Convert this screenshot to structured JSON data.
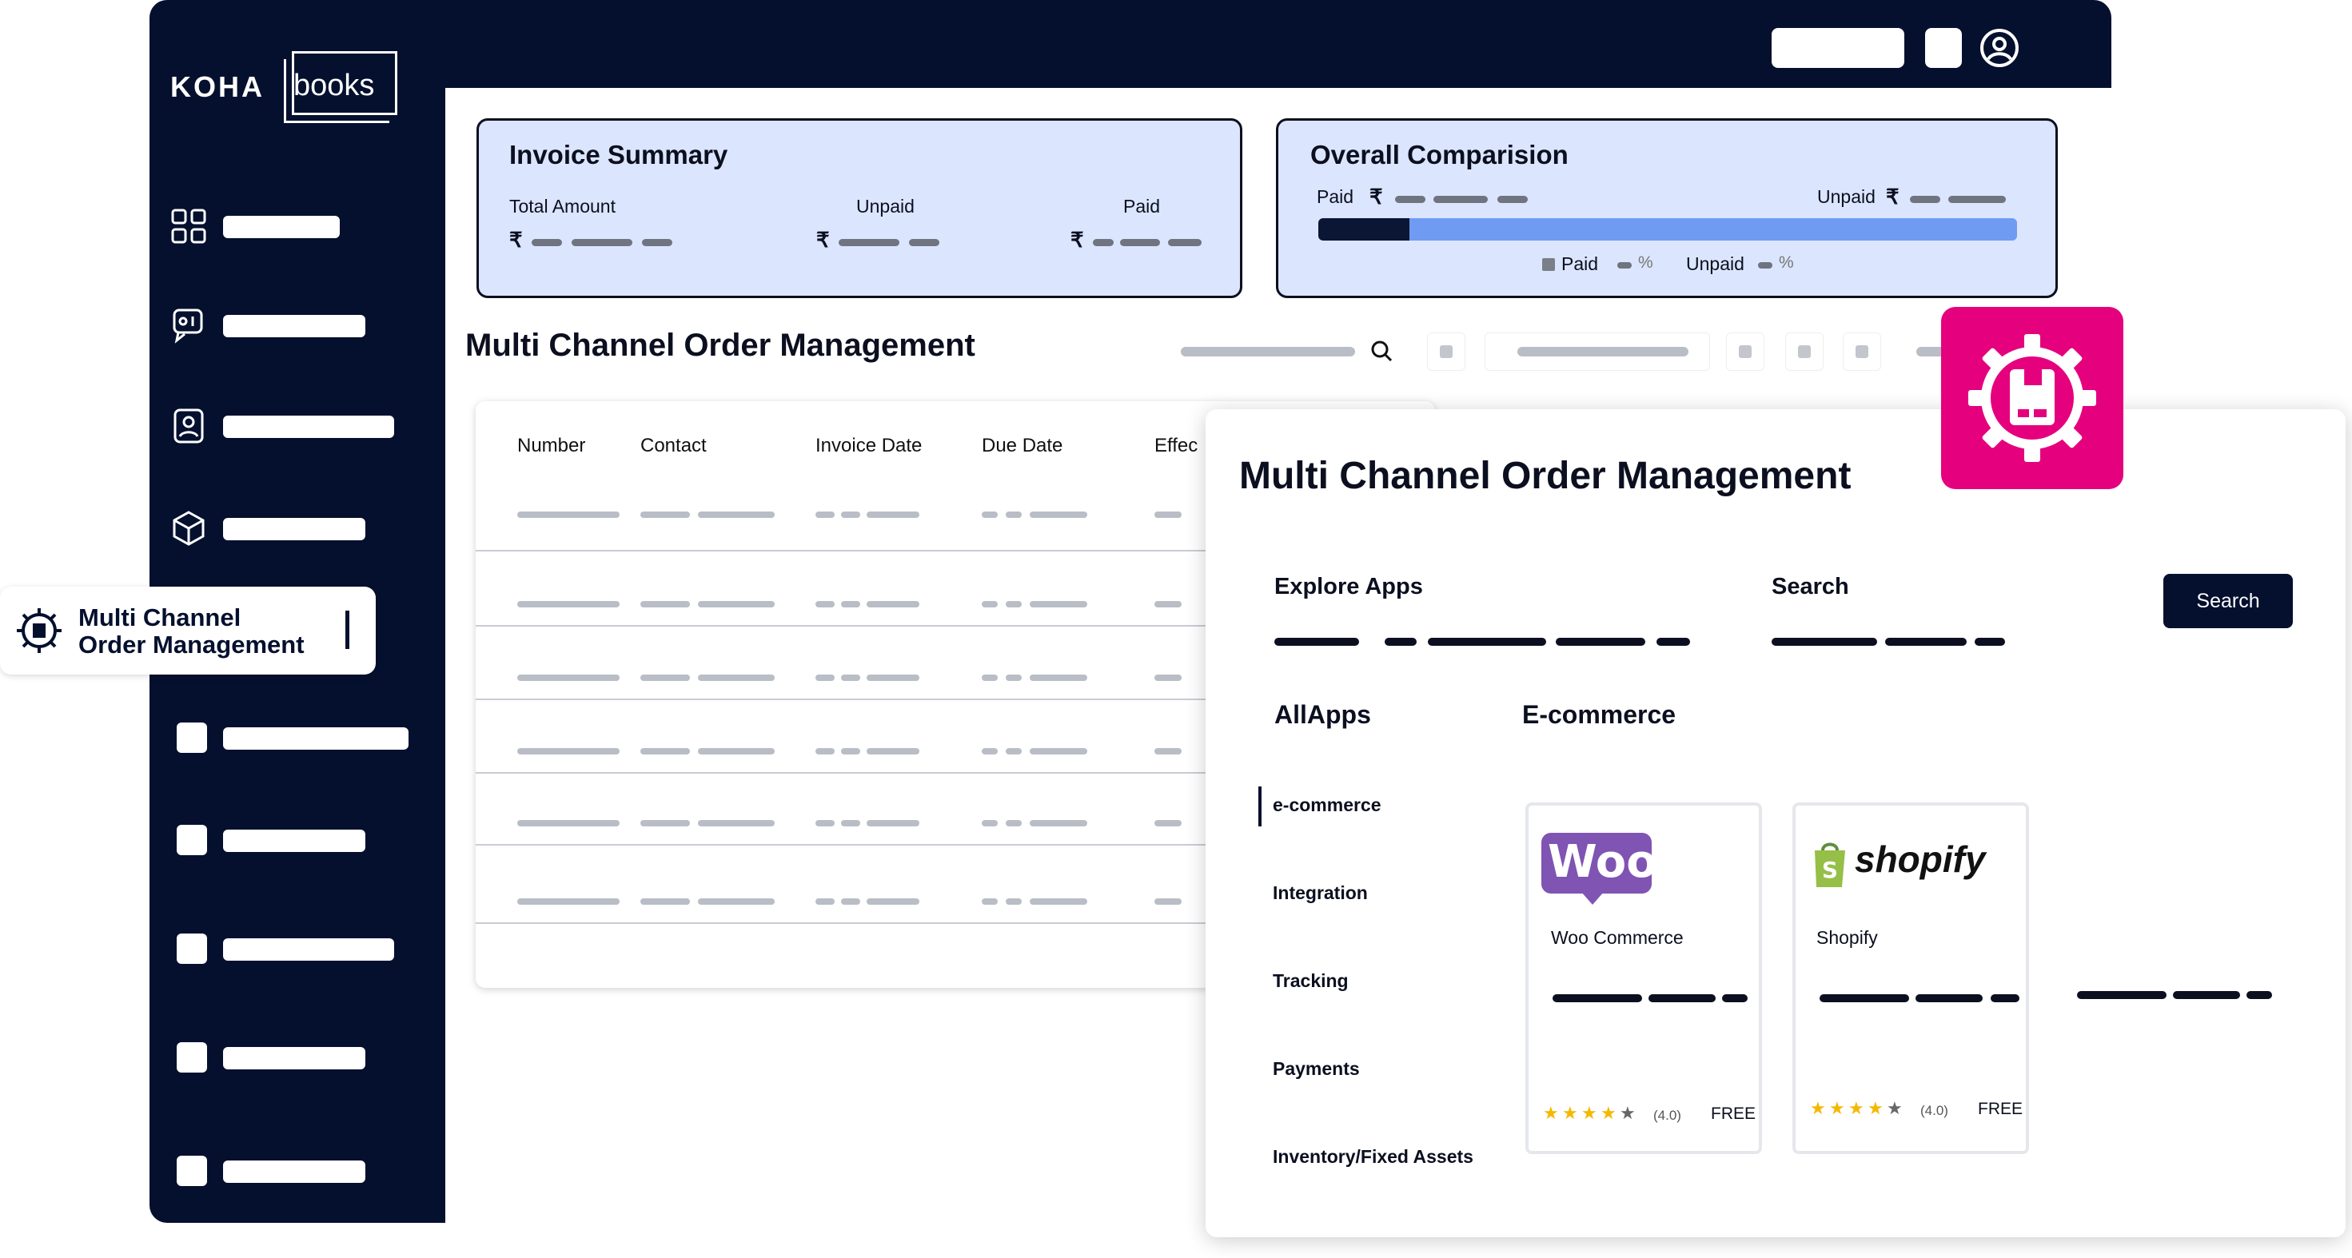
{
  "brand": {
    "logo_left": "KOHA",
    "logo_right": "books"
  },
  "topbar": {
    "profile_icon": "user-circle-icon"
  },
  "sidebar": {
    "items": [
      {
        "icon": "grid-icon"
      },
      {
        "icon": "chat-settings-icon"
      },
      {
        "icon": "contact-icon"
      },
      {
        "icon": "box-icon"
      },
      {
        "label_line1": "Multi Channel",
        "label_line2": "Order Management",
        "icon": "order-gear-icon"
      },
      {
        "icon": "square-icon"
      },
      {
        "icon": "square-icon"
      },
      {
        "icon": "square-icon"
      },
      {
        "icon": "square-icon"
      },
      {
        "icon": "square-icon"
      }
    ]
  },
  "invoice_summary": {
    "title": "Invoice Summary",
    "total_label": "Total Amount",
    "unpaid_label": "Unpaid",
    "paid_label": "Paid",
    "currency": "₹"
  },
  "overall": {
    "title": "Overall Comparision",
    "paid_label": "Paid",
    "unpaid_label": "Unpaid",
    "currency": "₹",
    "paid_fraction": 0.13,
    "legend_paid": "Paid",
    "legend_unpaid": "Unpaid",
    "percent": "%",
    "bar_dark": "#0a1633",
    "bar_light": "#6f9cf2"
  },
  "main": {
    "title": "Multi Channel Order Management",
    "columns": [
      "Number",
      "Contact",
      "Invoice Date",
      "Due Date",
      "Effec"
    ]
  },
  "modal": {
    "title": "Multi Channel Order Management",
    "explore_label": "Explore Apps",
    "search_label": "Search",
    "search_button": "Search",
    "allapps_label": "AllApps",
    "section_title": "E-commerce",
    "categories": [
      "e-commerce",
      "Integration",
      "Tracking",
      "Payments",
      "Inventory/Fixed Assets"
    ],
    "apps": [
      {
        "logo": "Woo",
        "name": "Woo Commerce",
        "rating": "(4.0)",
        "price": "FREE"
      },
      {
        "logo": "shopify",
        "name": "Shopify",
        "rating": "(4.0)",
        "price": "FREE"
      }
    ],
    "badge_color": "#e5007e"
  }
}
